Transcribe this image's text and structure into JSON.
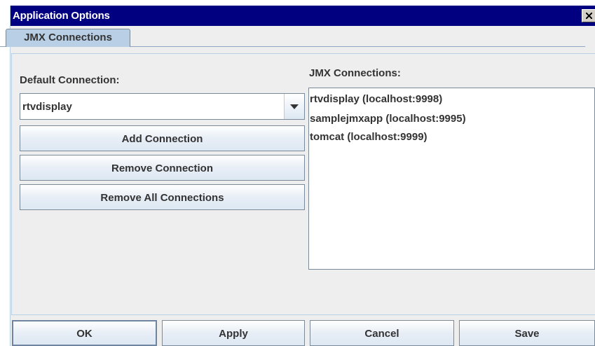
{
  "window": {
    "title": "Application Options"
  },
  "tabs": [
    {
      "label": "JMX Connections",
      "selected": true
    }
  ],
  "default_connection": {
    "label": "Default Connection:",
    "selected_value": "rtvdisplay"
  },
  "actions": {
    "add": "Add Connection",
    "remove": "Remove Connection",
    "remove_all": "Remove All Connections"
  },
  "connections": {
    "label": "JMX Connections:",
    "items": [
      "rtvdisplay (localhost:9998)",
      "samplejmxapp (localhost:9995)",
      "tomcat (localhost:9999)"
    ]
  },
  "footer": {
    "ok": "OK",
    "apply": "Apply",
    "cancel": "Cancel",
    "save": "Save"
  },
  "colors": {
    "titlebar": "#000080",
    "tab_selected": "#b8cfe5",
    "panel_bg": "#eeeeee"
  },
  "icons": {
    "close": "close-icon",
    "dropdown": "chevron-down-icon"
  }
}
